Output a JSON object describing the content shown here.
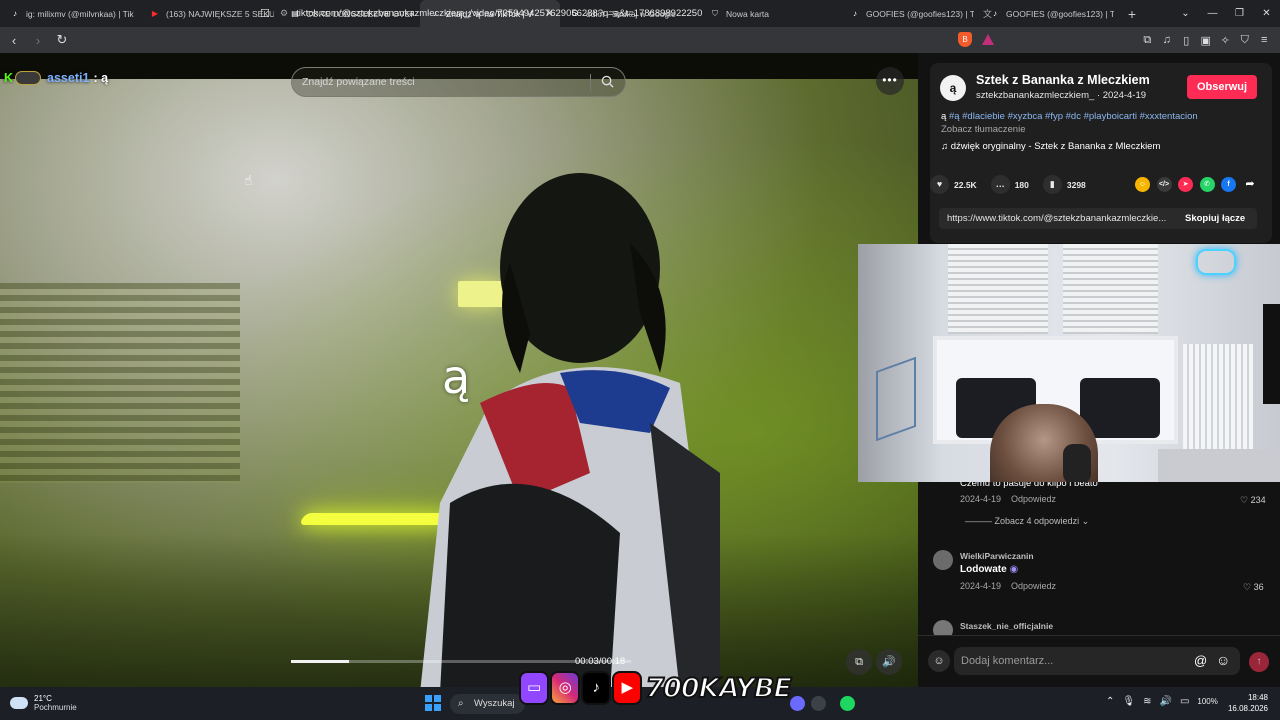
{
  "tabs": [
    {
      "title": "ig: milixmv (@milvnkaa) | TikTo",
      "favicon": "tiktok-icon",
      "active": false
    },
    {
      "title": "(163) NAJWIĘKSZE 5 SEKUND",
      "favicon": "youtube-icon",
      "active": false
    },
    {
      "title": "CORE LONGSLEEVE OVERSIZE",
      "favicon": "store-icon",
      "active": false
    },
    {
      "title": "Znajdź 'ą' na TikTok | V",
      "favicon": "tiktok-icon",
      "active": true
    },
    {
      "title": "odiot - Szukaj w Google",
      "favicon": "google-icon",
      "active": false
    },
    {
      "title": "Nowa karta",
      "favicon": "brave-icon",
      "active": false
    },
    {
      "title": "GOOFIES (@goofies123) | TikT",
      "favicon": "tiktok-icon",
      "active": false
    },
    {
      "title": "GOOFIES (@goofies123) | TikT",
      "favicon": "tiktok-icon",
      "active": false
    }
  ],
  "address_bar": {
    "url": "tiktok.com/@sztekzbanankazmleczkiem_/video/7359494257629056288?q=ą&t=1786898922250"
  },
  "video": {
    "stream_user": "asseti1",
    "stream_message": ": ą",
    "search_placeholder": "Znajdź powiązane treści",
    "caption": "ą",
    "time": "00:03/00:18",
    "progress": 0.17
  },
  "post": {
    "author": "Sztek z Bananka z Mleczkiem",
    "handle_date": "sztekzbanankazmleczkiem_ · 2024-4-19",
    "follow_label": "Obserwuj",
    "desc_prefix": "ą ",
    "desc_tags": "#ą #dlaciebie #xyzbca #fyp #dc #playboicarti #xxxtentacion",
    "translate": "Zobacz tłumaczenie",
    "sound": "dźwięk oryginalny - Sztek z Bananka z Mleczkiem",
    "likes": "22.5K",
    "comments": "180",
    "saves": "3298",
    "share_url": "https://www.tiktok.com/@sztekzbanankazmleczkie...",
    "copy_label": "Skopiuj łącze"
  },
  "comments": [
    {
      "text": "Czemu to pasuje do klipo i beato",
      "date": "2024-4-19",
      "reply": "Odpowiedz",
      "likes": "234",
      "more_replies": "Zobacz 4 odpowiedzi"
    },
    {
      "user": "WielkiParwiczanin",
      "text": "Lodowate",
      "date": "2024-4-19",
      "reply": "Odpowiedz",
      "likes": "36"
    },
    {
      "user": "Staszek_nie_officjalnie"
    }
  ],
  "comment_input": {
    "placeholder": "Dodaj komentarz..."
  },
  "overlay_logo": {
    "text": "700KAYBE"
  },
  "taskbar": {
    "temp": "21°C",
    "weather": "Pochmurnie",
    "search_label": "Wyszukaj",
    "battery": "100%",
    "time": "18:48",
    "date": "16.08.2026"
  },
  "colors": {
    "accent": "#fe2c55",
    "tag": "#8bb7f0",
    "kick": "#53fc18"
  }
}
